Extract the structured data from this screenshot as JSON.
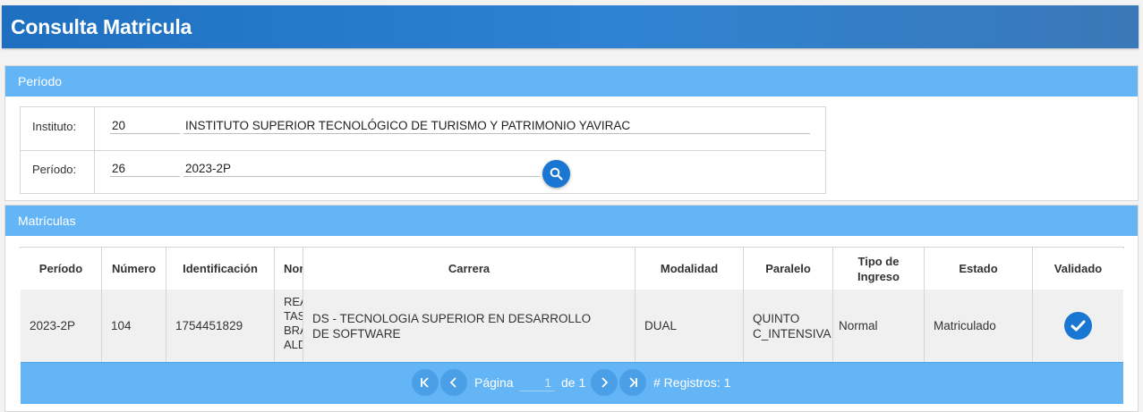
{
  "page": {
    "title": "Consulta Matricula"
  },
  "periodo_panel": {
    "header": "Período",
    "instituto": {
      "label": "Instituto:",
      "code": "20",
      "name": "INSTITUTO SUPERIOR TECNOLÓGICO DE TURISMO Y PATRIMONIO YAVIRAC"
    },
    "periodo": {
      "label": "Período:",
      "code": "26",
      "name": "2023-2P"
    },
    "search_icon": "search-icon"
  },
  "matriculas_panel": {
    "header": "Matrículas",
    "columns": [
      "Período",
      "Número",
      "Identificación",
      "Nor",
      "Carrera",
      "Modalidad",
      "Paralelo",
      "Tipo de Ingreso",
      "Estado",
      "Validado"
    ],
    "rows": [
      {
        "periodo": "2023-2P",
        "numero": "104",
        "identificacion": "1754451829",
        "nombre": "REA\nTAS\nBRA\nALD",
        "carrera": "DS - TECNOLOGIA SUPERIOR EN DESARROLLO DE SOFTWARE",
        "modalidad": "DUAL",
        "paralelo": "QUINTO C_INTENSIVA",
        "tipo_ingreso": "Normal",
        "estado": "Matriculado",
        "validado": "check-circle-icon"
      }
    ],
    "paginator": {
      "page_label": "Página",
      "page_value": "1",
      "of_label": "de 1",
      "records_label": "# Registros: 1"
    }
  },
  "colors": {
    "title_bar": "#1e6fc0",
    "panel_header": "#64b5f6",
    "accent": "#1976d2"
  }
}
